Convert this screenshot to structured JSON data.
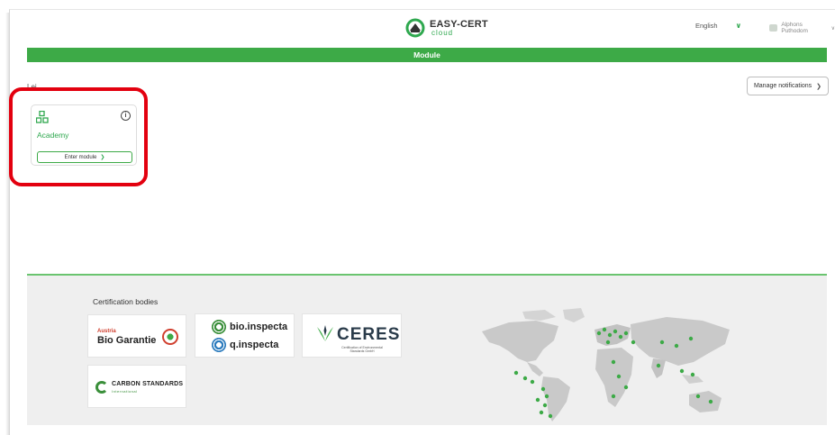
{
  "header": {
    "brand_title": "EASY-CERT",
    "brand_subtitle": "cloud",
    "language": "English",
    "user_name": "Alphons Puthodom"
  },
  "module_bar": {
    "title": "Module"
  },
  "notifications": {
    "button_label": "Manage notifications"
  },
  "clipped_heading": "Lei",
  "modules": [
    {
      "title": "Academy",
      "button_label": "Enter module"
    }
  ],
  "footer": {
    "certification_title": "Certification bodies",
    "logos": {
      "bio_garantie_small": "Austria",
      "bio_garantie_main": "Bio Garantie",
      "bio_inspecta": "bio.inspecta",
      "q_inspecta": "q.inspecta",
      "ceres_name": "CERES",
      "ceres_sub": "Certification of Environmental Standards GmbH",
      "carbon_name": "CARBON STANDARDS",
      "carbon_sub": "International"
    }
  },
  "colors": {
    "accent": "#3daa47",
    "highlight": "#e3000f",
    "footer_bg": "#efefef"
  },
  "icons": {
    "brand": "cloud-logo-icon",
    "module": "modules-grid-icon",
    "info": "info-icon",
    "chevron": "chevron-right-icon"
  }
}
